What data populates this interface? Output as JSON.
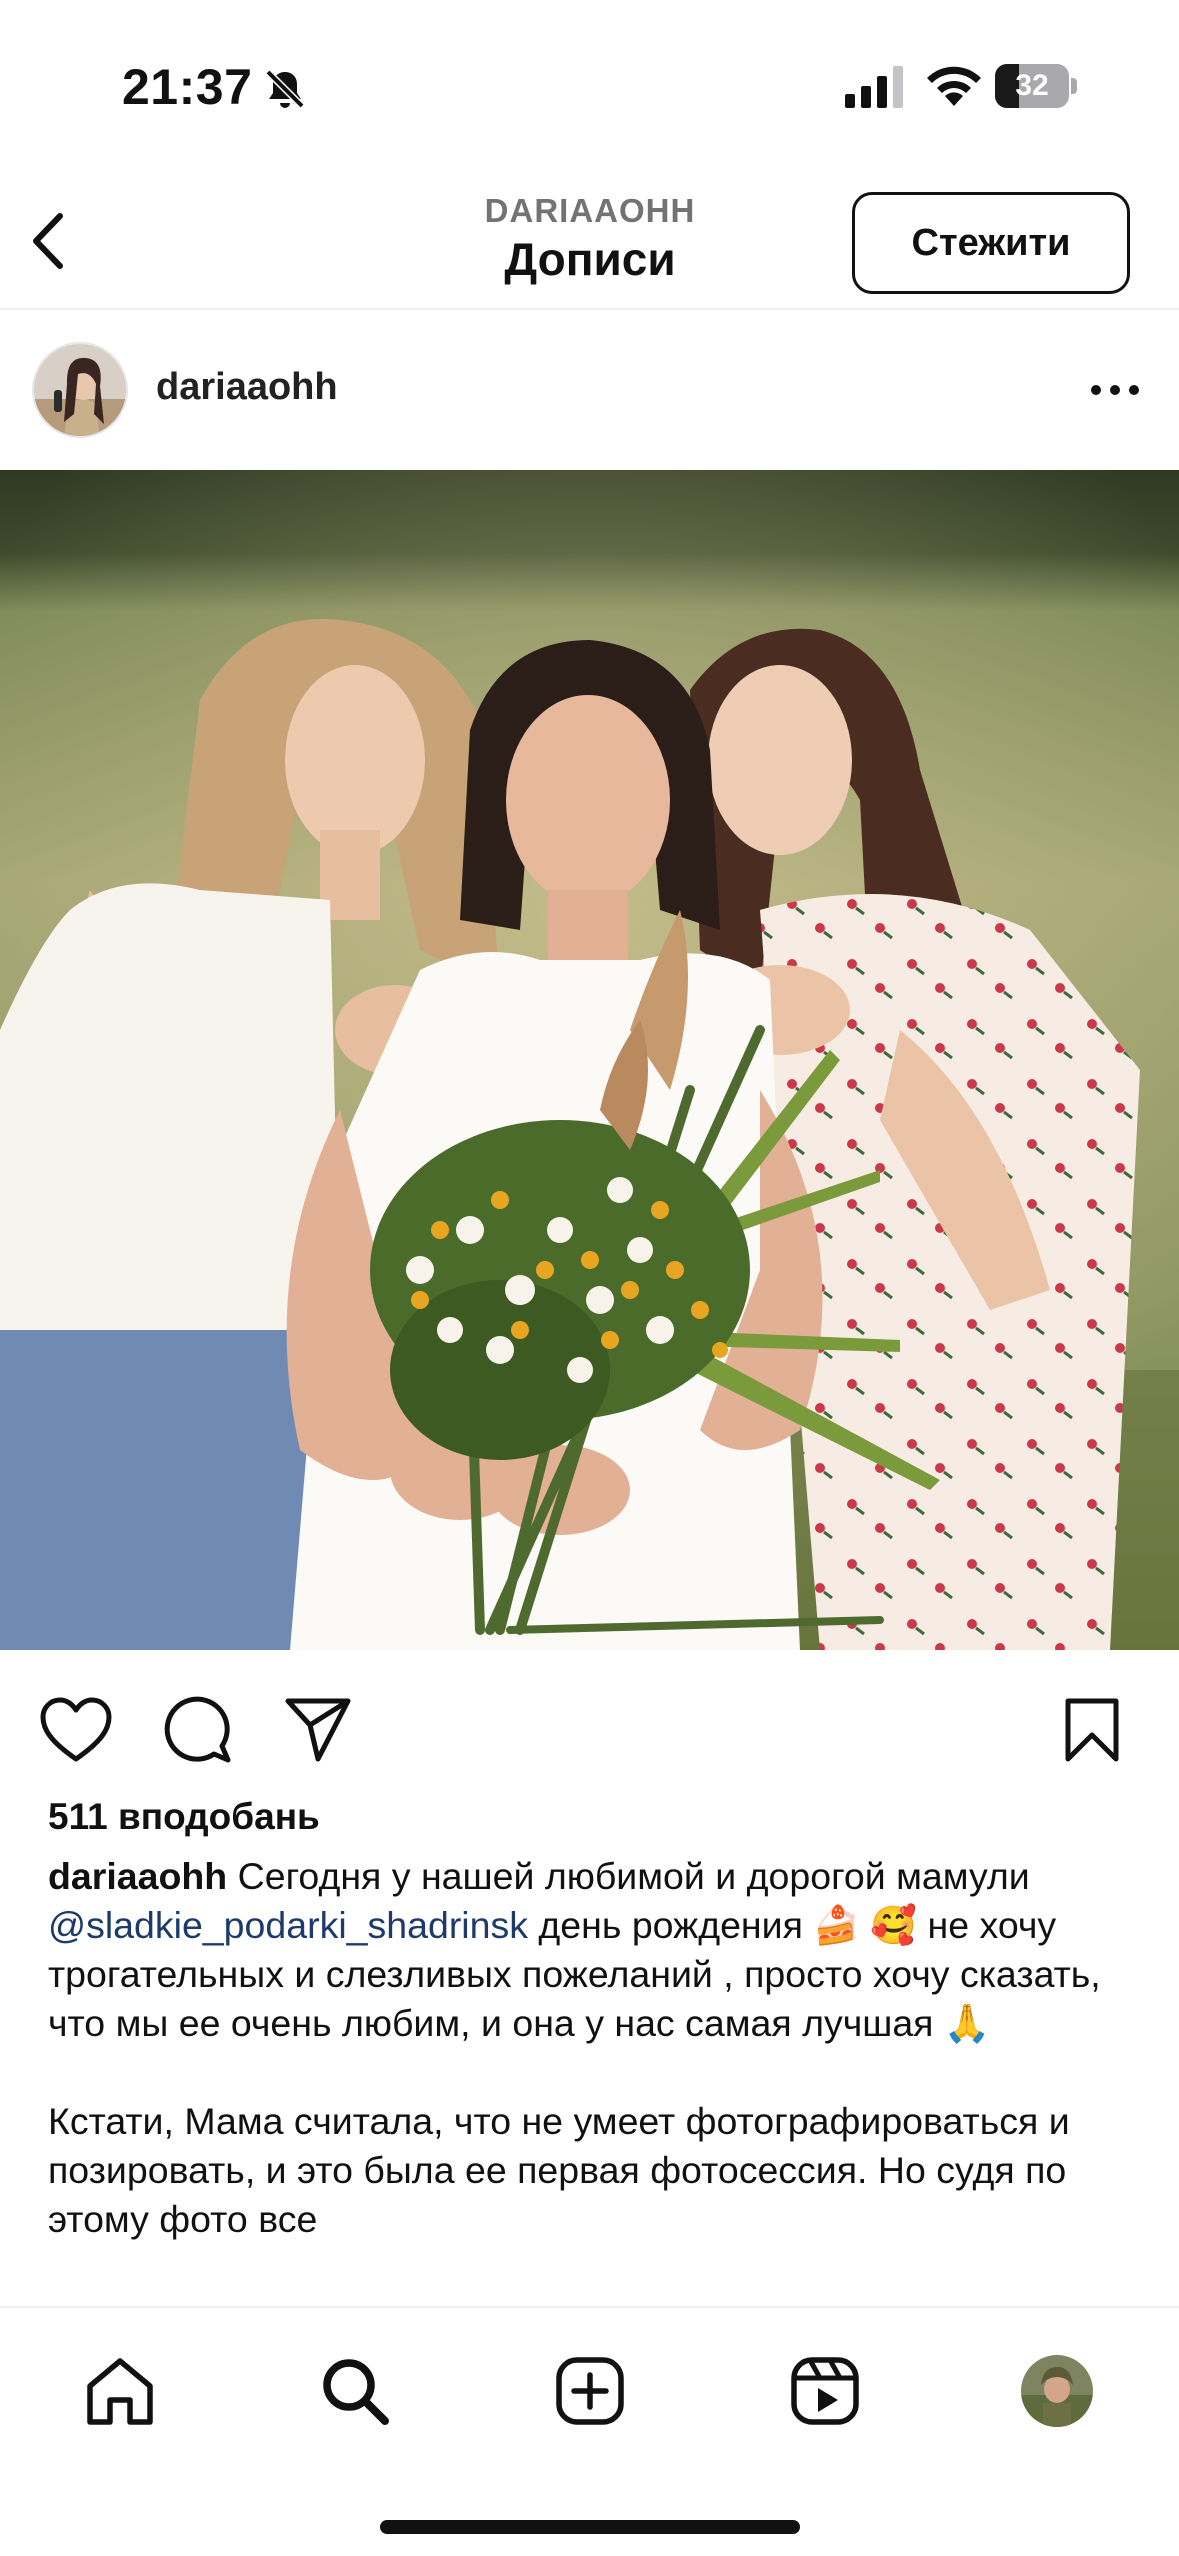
{
  "status_bar": {
    "time": "21:37",
    "battery_level": "32",
    "icons": [
      "bell-off-icon",
      "cellular-signal-icon",
      "wifi-icon",
      "battery-icon"
    ]
  },
  "header": {
    "subtitle": "DARIAAOHH",
    "title": "Дописи",
    "follow_label": "Стежити",
    "back_icon": "chevron-left-icon"
  },
  "post": {
    "username": "dariaaohh",
    "more_icon": "more-horizontal-icon",
    "likes": "511 вподобань",
    "caption": {
      "username": "dariaaohh",
      "text_part1": " Сегодня у нашей любимой и дорогой мамули ",
      "mention": "@sladkie_podarki_shadrinsk",
      "text_part2": " день рождения 🍰 🥰 не хочу трогательных и слезливых пожеланий , просто хочу сказать, что мы ее очень любим, и она у нас самая лучшая 🙏",
      "paragraph2": "Кстати, Мама считала, что не умеет фотографироваться и позировать, и это была ее первая фотосессия. Но судя по этому фото все"
    },
    "action_icons": [
      "heart-icon",
      "comment-icon",
      "share-icon",
      "bookmark-icon"
    ]
  },
  "bottom_nav": {
    "items": [
      "home-icon",
      "search-icon",
      "create-icon",
      "reels-icon",
      "profile-avatar"
    ]
  },
  "colors": {
    "text": "#111111",
    "secondary": "#737373",
    "mention": "#1d3a6b",
    "divider": "#efefef"
  }
}
